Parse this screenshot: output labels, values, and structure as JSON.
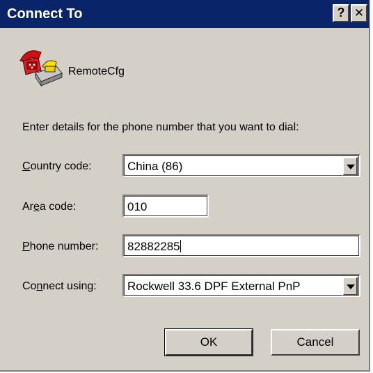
{
  "window": {
    "title": "Connect To",
    "help_button": "?",
    "close_button": "✕"
  },
  "connection": {
    "name": "RemoteCfg",
    "icon": "telephone-modem-icon"
  },
  "instructions": "Enter details for the phone number that you want to dial:",
  "form": {
    "country_code": {
      "label_prefix": "",
      "label_accel": "C",
      "label_suffix": "ountry code:",
      "value": "China (86)"
    },
    "area_code": {
      "label_prefix": "Ar",
      "label_accel": "e",
      "label_suffix": "a code:",
      "value": "010"
    },
    "phone_number": {
      "label_prefix": "",
      "label_accel": "P",
      "label_suffix": "hone number:",
      "value": "82882285"
    },
    "connect_using": {
      "label_prefix": "Co",
      "label_accel": "n",
      "label_suffix": "nect using:",
      "value": "Rockwell 33.6 DPF External PnP"
    }
  },
  "buttons": {
    "ok": "OK",
    "cancel": "Cancel"
  }
}
